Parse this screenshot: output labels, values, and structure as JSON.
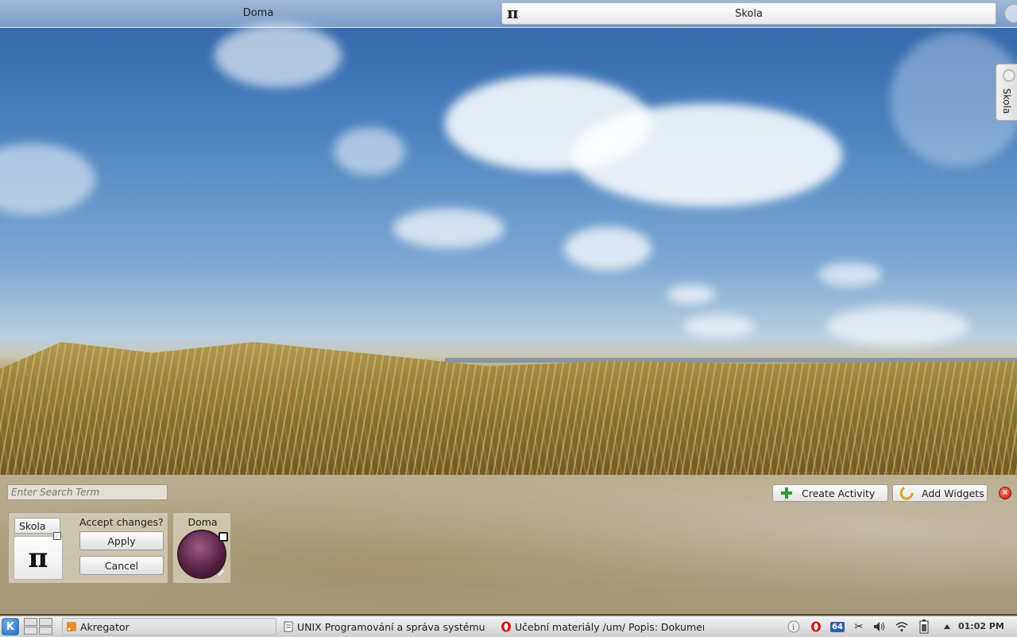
{
  "activities": {
    "tab_doma": "Doma",
    "tab_skola": "Skola",
    "skola_icon_glyph": "π"
  },
  "side_tab": {
    "label": "Skola"
  },
  "manager": {
    "search_placeholder": "Enter Search Term",
    "create_activity_label": "Create Activity",
    "add_widgets_label": "Add Widgets",
    "close_glyph": "×",
    "card_skola": {
      "name": "Skola",
      "icon_glyph": "π",
      "accept_label": "Accept changes?",
      "apply_label": "Apply",
      "cancel_label": "Cancel"
    },
    "card_doma": {
      "name": "Doma"
    }
  },
  "taskbar": {
    "kde_glyph": "K",
    "tasks": [
      {
        "label": "Akregator",
        "icon": "rss-feed-icon"
      },
      {
        "label": "UNIX  Programování a správa systému",
        "icon": "document-icon"
      },
      {
        "label": "Učební materiály /um/ Popis: Dokumen",
        "icon": "opera-icon"
      }
    ],
    "tray": {
      "battery_pct": "64",
      "clock": "01:02 PM"
    }
  },
  "colors": {
    "accent_blue": "#1f63b4",
    "close_red": "#c51c0e",
    "create_green": "#2e9b2e"
  }
}
